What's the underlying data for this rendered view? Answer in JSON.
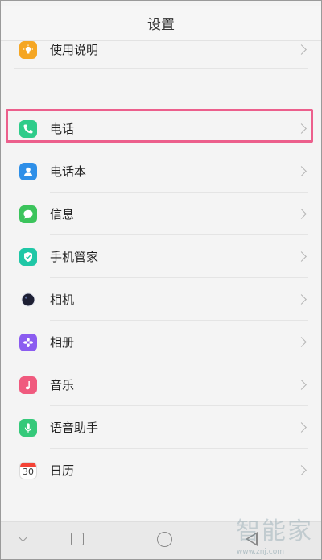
{
  "header": {
    "title": "设置"
  },
  "items": [
    {
      "key": "manual",
      "label": "使用说明",
      "icon": "lightbulb-icon",
      "color": "#f5a623"
    },
    {
      "key": "phone",
      "label": "电话",
      "icon": "phone-icon",
      "color": "#2ecc8a"
    },
    {
      "key": "contacts",
      "label": "电话本",
      "icon": "contact-icon",
      "color": "#2e8fe8"
    },
    {
      "key": "messages",
      "label": "信息",
      "icon": "message-icon",
      "color": "#3cc45c"
    },
    {
      "key": "manager",
      "label": "手机管家",
      "icon": "shield-icon",
      "color": "#1fc7a6"
    },
    {
      "key": "camera",
      "label": "相机",
      "icon": "camera-lens-icon",
      "color": "#1d1f33"
    },
    {
      "key": "album",
      "label": "相册",
      "icon": "flower-icon",
      "color": "#8b5cf0"
    },
    {
      "key": "music",
      "label": "音乐",
      "icon": "music-note-icon",
      "color": "#f05a7e"
    },
    {
      "key": "voice",
      "label": "语音助手",
      "icon": "microphone-icon",
      "color": "#35c97a"
    },
    {
      "key": "calendar",
      "label": "日历",
      "icon": "calendar-icon",
      "color": "#f44336",
      "day": "30"
    }
  ],
  "watermark": {
    "text": "智能家",
    "sub": "www.znj.com"
  },
  "highlight_color": "#ec5f8c"
}
